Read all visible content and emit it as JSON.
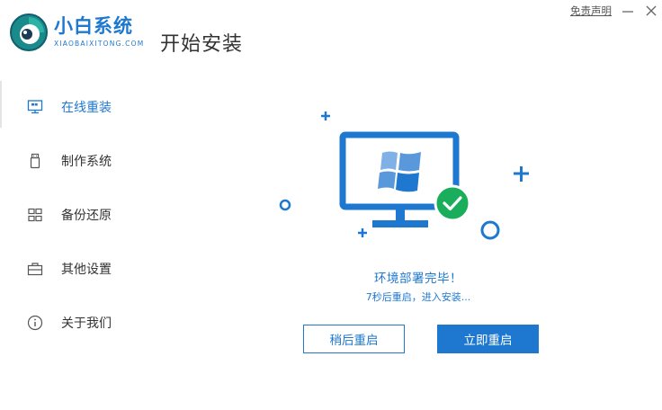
{
  "brand": {
    "name": "小白系统",
    "subtitle": "XIAOBAIXITONG.COM"
  },
  "page_title": "开始安装",
  "titlebar": {
    "disclaimer": "免责声明"
  },
  "sidebar": {
    "items": [
      {
        "label": "在线重装",
        "icon": "monitor-icon",
        "active": true
      },
      {
        "label": "制作系统",
        "icon": "usb-drive-icon",
        "active": false
      },
      {
        "label": "备份还原",
        "icon": "backup-grid-icon",
        "active": false
      },
      {
        "label": "其他设置",
        "icon": "toolbox-icon",
        "active": false
      },
      {
        "label": "关于我们",
        "icon": "info-icon",
        "active": false
      }
    ]
  },
  "status": {
    "title": "环境部署完毕！",
    "subtitle": "7秒后重启，进入安装..."
  },
  "buttons": {
    "later": "稍后重启",
    "now": "立即重启"
  },
  "colors": {
    "accent": "#1e78d0",
    "success": "#1aad5b",
    "text": "#333333"
  }
}
